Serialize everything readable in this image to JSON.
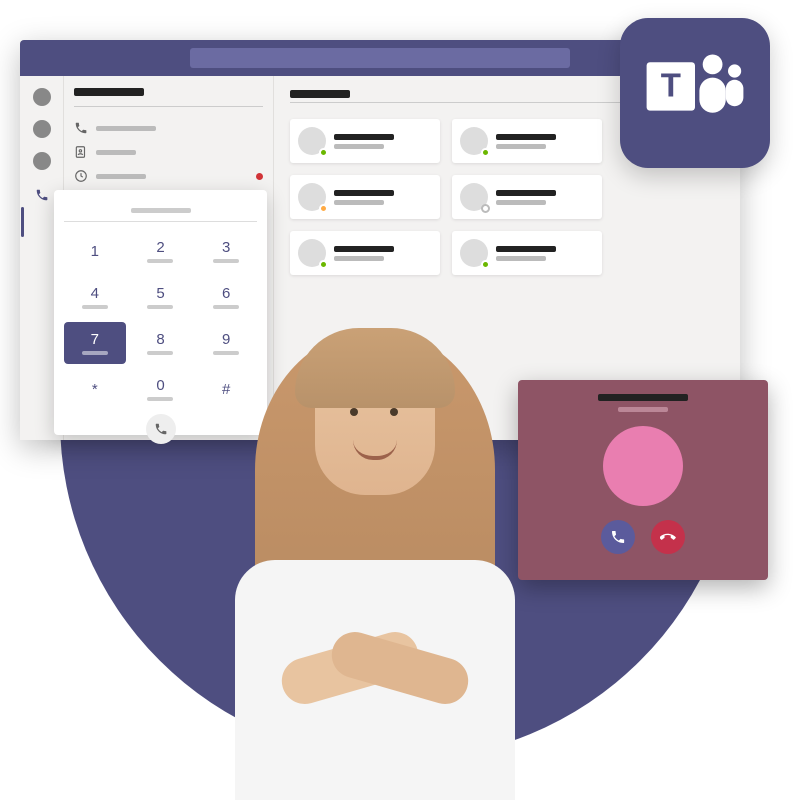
{
  "brand": {
    "app_name": "Microsoft Teams",
    "accent_color": "#4e4e80"
  },
  "dialpad": {
    "keys": [
      "1",
      "2",
      "3",
      "4",
      "5",
      "6",
      "7",
      "8",
      "9",
      "*",
      "0",
      "#"
    ],
    "active_key": "7",
    "call_icon": "phone"
  },
  "contacts": [
    {
      "presence": "online"
    },
    {
      "presence": "online"
    },
    {
      "presence": "away"
    },
    {
      "presence": "offline"
    },
    {
      "presence": "online"
    },
    {
      "presence": "online"
    }
  ],
  "incoming_call": {
    "accept_icon": "phone",
    "decline_icon": "phone-hangup"
  }
}
